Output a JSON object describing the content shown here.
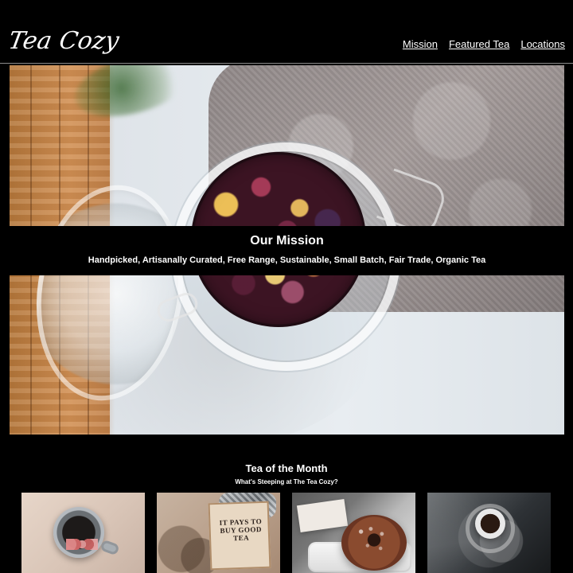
{
  "header": {
    "logo_text": "Tea Cozy",
    "nav": [
      {
        "label": "Mission"
      },
      {
        "label": "Featured Tea"
      },
      {
        "label": "Locations"
      }
    ]
  },
  "hero": {
    "title": "Our Mission",
    "subtitle": "Handpicked, Artisanally Curated, Free Range, Sustainable, Small Batch, Fair Trade, Organic Tea"
  },
  "tea_of_month": {
    "title": "Tea of the Month",
    "subtitle": "What's Steeping at The Tea Cozy?",
    "thumb_texts": {
      "crate_label": "IT PAYS TO BUY GOOD TEA"
    }
  }
}
